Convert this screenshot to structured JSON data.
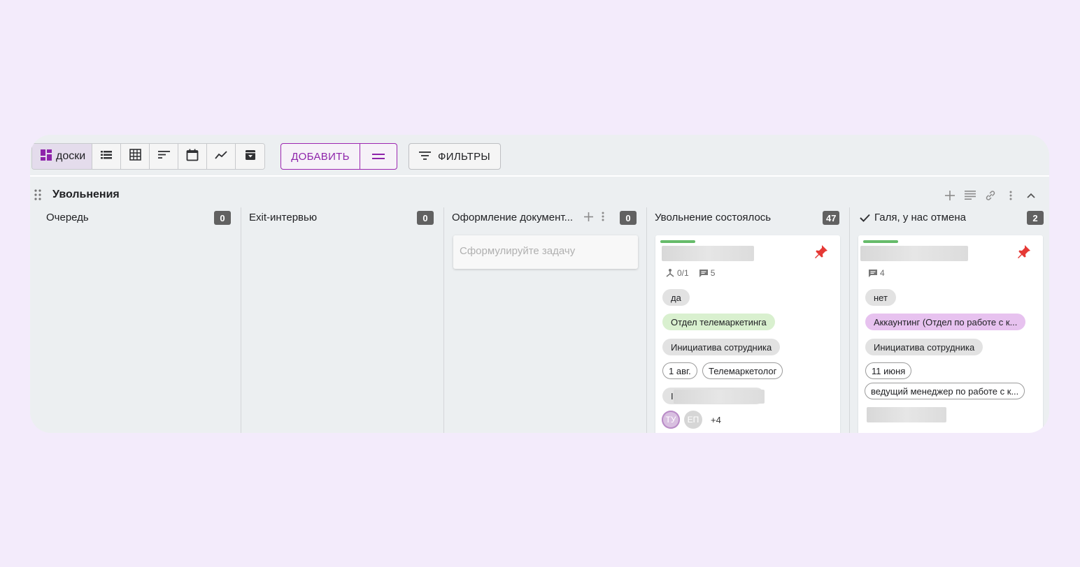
{
  "toolbar": {
    "views": [
      {
        "label": "доски",
        "icon": "board-icon"
      },
      {
        "icon": "list-icon"
      },
      {
        "icon": "table-grid-icon"
      },
      {
        "icon": "sort-icon"
      },
      {
        "icon": "calendar-icon"
      },
      {
        "icon": "chart-line-icon"
      },
      {
        "icon": "archive-icon"
      }
    ],
    "add_label": "ДОБАВИТЬ",
    "filters_label": "ФИЛЬТРЫ"
  },
  "board": {
    "title": "Увольнения"
  },
  "columns": [
    {
      "title": "Очередь",
      "count": "0"
    },
    {
      "title": "Exit-интервью",
      "count": "0"
    },
    {
      "title": "Оформление документ...",
      "count": "0",
      "task_placeholder": "Сформулируйте задачу"
    },
    {
      "title": "Увольнение состоялось",
      "count": "47"
    },
    {
      "title": "Галя, у нас отмена",
      "count": "2"
    }
  ],
  "cards": [
    {
      "subtasks": "0/1",
      "comments": "5",
      "chips": {
        "answer": "да",
        "department": "Отдел телемаркетинга",
        "reason": "Инициатива сотрудника",
        "date": "1 авг.",
        "position": "Телемаркетолог",
        "partial": "I"
      },
      "avatars": [
        "ТУ",
        "ЕП"
      ],
      "more": "+4"
    },
    {
      "comments": "4",
      "chips": {
        "answer": "нет",
        "department": "Аккаунтинг (Отдел по работе с к...",
        "reason": "Инициатива сотрудника",
        "date": "11 июня",
        "position": "ведущий менеджер по работе с к..."
      }
    }
  ],
  "colors": {
    "accent": "#8e24aa",
    "progress": "#66bb6a",
    "pin": "#e53935",
    "count_badge": "#616161"
  }
}
